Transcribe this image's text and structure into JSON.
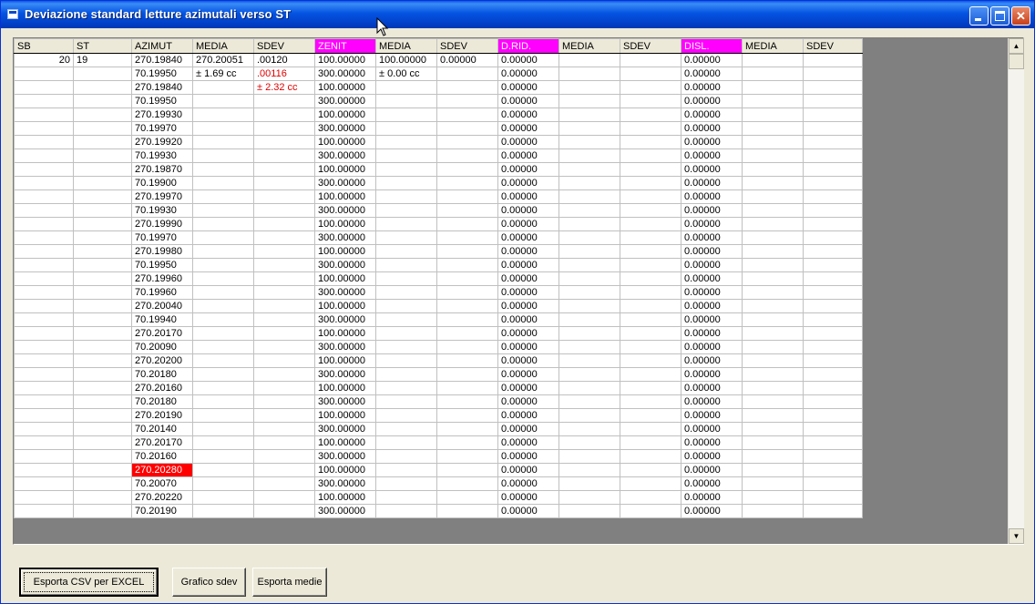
{
  "window": {
    "title": "Deviazione standard letture azimutali verso ST",
    "controls": {
      "minimize": "minimize-icon",
      "maximize": "maximize-icon",
      "close": "close-icon"
    }
  },
  "colors": {
    "highlight_header": "#ff00ff",
    "error_cell": "#ff0000",
    "sdev_text": "#e00000"
  },
  "grid": {
    "headers": [
      {
        "label": "SB",
        "highlight": false
      },
      {
        "label": "ST",
        "highlight": false
      },
      {
        "label": "AZIMUT",
        "highlight": false
      },
      {
        "label": "MEDIA",
        "highlight": false
      },
      {
        "label": "SDEV",
        "highlight": false
      },
      {
        "label": "ZENIT",
        "highlight": true
      },
      {
        "label": "MEDIA",
        "highlight": false
      },
      {
        "label": "SDEV",
        "highlight": false
      },
      {
        "label": "D.RID.",
        "highlight": true
      },
      {
        "label": "MEDIA",
        "highlight": false
      },
      {
        "label": "SDEV",
        "highlight": false
      },
      {
        "label": "DISL.",
        "highlight": true
      },
      {
        "label": "MEDIA",
        "highlight": false
      },
      {
        "label": "SDEV",
        "highlight": false
      }
    ],
    "rows": [
      [
        "20",
        "19",
        "270.19840",
        " 270.20051",
        ".00120",
        "100.00000",
        " 100.00000",
        "0.00000",
        "0.00000",
        "",
        "",
        "0.00000",
        "",
        ""
      ],
      [
        "",
        "",
        "70.19950",
        "± 1.69 cc",
        ".00116",
        "300.00000",
        "± 0.00 cc",
        "",
        "0.00000",
        "",
        "",
        "0.00000",
        "",
        ""
      ],
      [
        "",
        "",
        "270.19840",
        "",
        "± 2.32 cc",
        "100.00000",
        "",
        "",
        "0.00000",
        "",
        "",
        "0.00000",
        "",
        ""
      ],
      [
        "",
        "",
        "70.19950",
        "",
        "",
        "300.00000",
        "",
        "",
        "0.00000",
        "",
        "",
        "0.00000",
        "",
        ""
      ],
      [
        "",
        "",
        "270.19930",
        "",
        "",
        "100.00000",
        "",
        "",
        "0.00000",
        "",
        "",
        "0.00000",
        "",
        ""
      ],
      [
        "",
        "",
        "70.19970",
        "",
        "",
        "300.00000",
        "",
        "",
        "0.00000",
        "",
        "",
        "0.00000",
        "",
        ""
      ],
      [
        "",
        "",
        "270.19920",
        "",
        "",
        "100.00000",
        "",
        "",
        "0.00000",
        "",
        "",
        "0.00000",
        "",
        ""
      ],
      [
        "",
        "",
        "70.19930",
        "",
        "",
        "300.00000",
        "",
        "",
        "0.00000",
        "",
        "",
        "0.00000",
        "",
        ""
      ],
      [
        "",
        "",
        "270.19870",
        "",
        "",
        "100.00000",
        "",
        "",
        "0.00000",
        "",
        "",
        "0.00000",
        "",
        ""
      ],
      [
        "",
        "",
        "70.19900",
        "",
        "",
        "300.00000",
        "",
        "",
        "0.00000",
        "",
        "",
        "0.00000",
        "",
        ""
      ],
      [
        "",
        "",
        "270.19970",
        "",
        "",
        "100.00000",
        "",
        "",
        "0.00000",
        "",
        "",
        "0.00000",
        "",
        ""
      ],
      [
        "",
        "",
        "70.19930",
        "",
        "",
        "300.00000",
        "",
        "",
        "0.00000",
        "",
        "",
        "0.00000",
        "",
        ""
      ],
      [
        "",
        "",
        "270.19990",
        "",
        "",
        "100.00000",
        "",
        "",
        "0.00000",
        "",
        "",
        "0.00000",
        "",
        ""
      ],
      [
        "",
        "",
        "70.19970",
        "",
        "",
        "300.00000",
        "",
        "",
        "0.00000",
        "",
        "",
        "0.00000",
        "",
        ""
      ],
      [
        "",
        "",
        "270.19980",
        "",
        "",
        "100.00000",
        "",
        "",
        "0.00000",
        "",
        "",
        "0.00000",
        "",
        ""
      ],
      [
        "",
        "",
        "70.19950",
        "",
        "",
        "300.00000",
        "",
        "",
        "0.00000",
        "",
        "",
        "0.00000",
        "",
        ""
      ],
      [
        "",
        "",
        "270.19960",
        "",
        "",
        "100.00000",
        "",
        "",
        "0.00000",
        "",
        "",
        "0.00000",
        "",
        ""
      ],
      [
        "",
        "",
        "70.19960",
        "",
        "",
        "300.00000",
        "",
        "",
        "0.00000",
        "",
        "",
        "0.00000",
        "",
        ""
      ],
      [
        "",
        "",
        "270.20040",
        "",
        "",
        "100.00000",
        "",
        "",
        "0.00000",
        "",
        "",
        "0.00000",
        "",
        ""
      ],
      [
        "",
        "",
        "70.19940",
        "",
        "",
        "300.00000",
        "",
        "",
        "0.00000",
        "",
        "",
        "0.00000",
        "",
        ""
      ],
      [
        "",
        "",
        "270.20170",
        "",
        "",
        "100.00000",
        "",
        "",
        "0.00000",
        "",
        "",
        "0.00000",
        "",
        ""
      ],
      [
        "",
        "",
        "70.20090",
        "",
        "",
        "300.00000",
        "",
        "",
        "0.00000",
        "",
        "",
        "0.00000",
        "",
        ""
      ],
      [
        "",
        "",
        "270.20200",
        "",
        "",
        "100.00000",
        "",
        "",
        "0.00000",
        "",
        "",
        "0.00000",
        "",
        ""
      ],
      [
        "",
        "",
        "70.20180",
        "",
        "",
        "300.00000",
        "",
        "",
        "0.00000",
        "",
        "",
        "0.00000",
        "",
        ""
      ],
      [
        "",
        "",
        "270.20160",
        "",
        "",
        "100.00000",
        "",
        "",
        "0.00000",
        "",
        "",
        "0.00000",
        "",
        ""
      ],
      [
        "",
        "",
        "70.20180",
        "",
        "",
        "300.00000",
        "",
        "",
        "0.00000",
        "",
        "",
        "0.00000",
        "",
        ""
      ],
      [
        "",
        "",
        "270.20190",
        "",
        "",
        "100.00000",
        "",
        "",
        "0.00000",
        "",
        "",
        "0.00000",
        "",
        ""
      ],
      [
        "",
        "",
        "70.20140",
        "",
        "",
        "300.00000",
        "",
        "",
        "0.00000",
        "",
        "",
        "0.00000",
        "",
        ""
      ],
      [
        "",
        "",
        "270.20170",
        "",
        "",
        "100.00000",
        "",
        "",
        "0.00000",
        "",
        "",
        "0.00000",
        "",
        ""
      ],
      [
        "",
        "",
        "70.20160",
        "",
        "",
        "300.00000",
        "",
        "",
        "0.00000",
        "",
        "",
        "0.00000",
        "",
        ""
      ],
      [
        "",
        "",
        "270.20280",
        "",
        "",
        "100.00000",
        "",
        "",
        "0.00000",
        "",
        "",
        "0.00000",
        "",
        ""
      ],
      [
        "",
        "",
        "70.20070",
        "",
        "",
        "300.00000",
        "",
        "",
        "0.00000",
        "",
        "",
        "0.00000",
        "",
        ""
      ],
      [
        "",
        "",
        "270.20220",
        "",
        "",
        "100.00000",
        "",
        "",
        "0.00000",
        "",
        "",
        "0.00000",
        "",
        ""
      ],
      [
        "",
        "",
        "70.20190",
        "",
        "",
        "300.00000",
        "",
        "",
        "0.00000",
        "",
        "",
        "0.00000",
        "",
        ""
      ]
    ],
    "flagged_cell": {
      "row": 30,
      "col": 2
    },
    "red_text_cells": [
      [
        1,
        4
      ],
      [
        2,
        4
      ]
    ]
  },
  "buttons": {
    "export_csv": "Esporta CSV per EXCEL",
    "chart_sdev": "Grafico sdev",
    "export_means": "Esporta medie"
  }
}
